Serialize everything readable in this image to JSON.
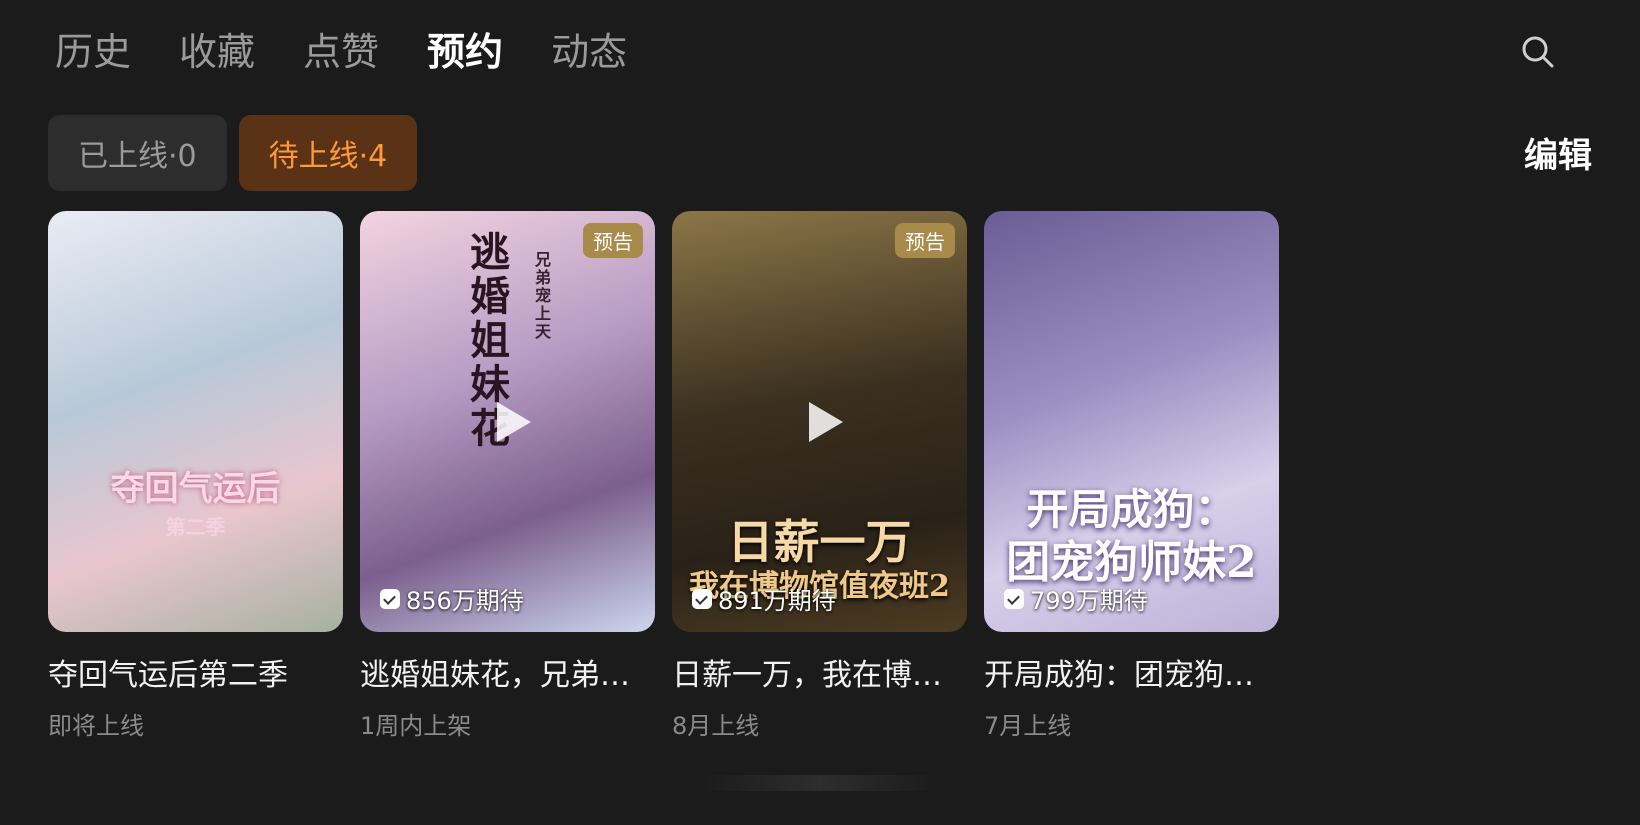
{
  "tabs": [
    {
      "label": "历史"
    },
    {
      "label": "收藏"
    },
    {
      "label": "点赞"
    },
    {
      "label": "预约"
    },
    {
      "label": "动态"
    }
  ],
  "active_tab": "预约",
  "filters": [
    {
      "label": "已上线·0"
    },
    {
      "label": "待上线·4"
    }
  ],
  "edit_label": "编辑",
  "cards": [
    {
      "title": "夺回气运后第二季",
      "subtitle": "即将上线",
      "poster_title": "夺回气运后",
      "poster_subtitle": "第二季",
      "badge": "",
      "expect": ""
    },
    {
      "title": "逃婚姐妹花，兄弟…",
      "subtitle": "1周内上架",
      "poster_title": "逃婚姐妹花",
      "poster_subtitle": "兄弟宠上天",
      "badge": "预告",
      "expect": "856万期待"
    },
    {
      "title": "日薪一万，我在博…",
      "subtitle": "8月上线",
      "poster_title": "日薪一万",
      "poster_subtitle": "我在博物馆值夜班2",
      "badge": "预告",
      "expect": "891万期待"
    },
    {
      "title": "开局成狗：团宠狗…",
      "subtitle": "7月上线",
      "poster_title": "开局成狗：",
      "poster_subtitle": "团宠狗师妹2",
      "badge": "",
      "expect": "799万期待"
    }
  ]
}
